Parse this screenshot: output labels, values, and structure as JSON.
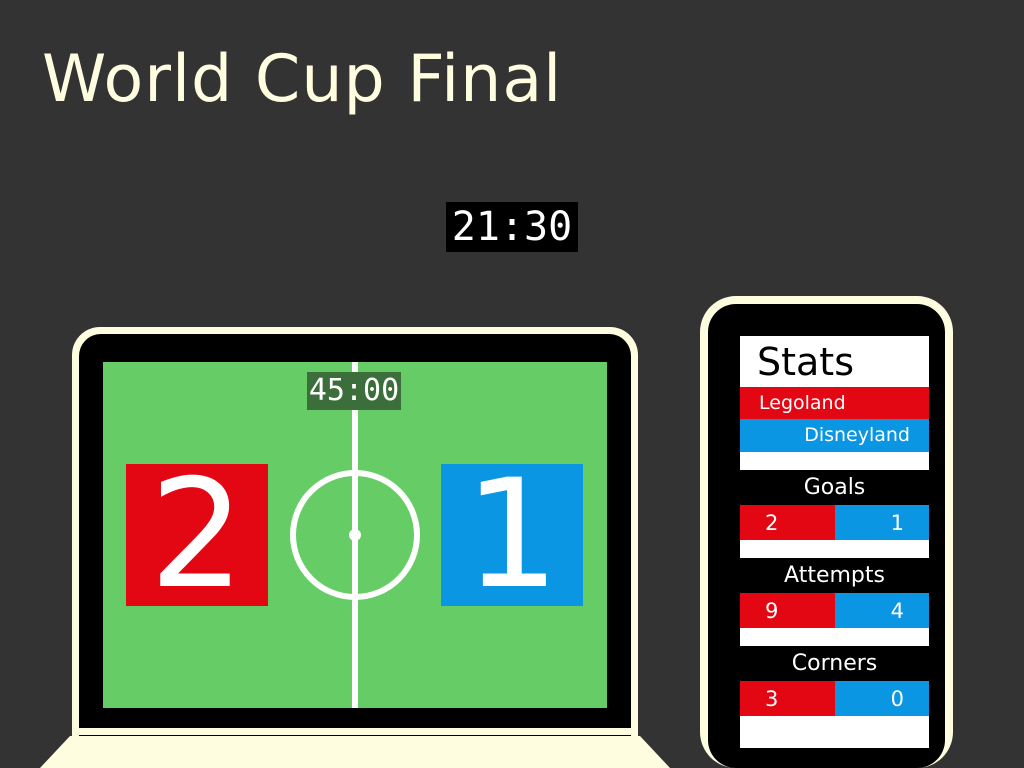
{
  "title": "World Cup Final",
  "clock": "21:30",
  "match": {
    "time": "45:00",
    "home_score": "2",
    "away_score": "1"
  },
  "stats": {
    "header": "Stats",
    "home_team": "Legoland",
    "away_team": "Disneyland",
    "rows": [
      {
        "label": "Goals",
        "home": "2",
        "away": "1"
      },
      {
        "label": "Attempts",
        "home": "9",
        "away": "4"
      },
      {
        "label": "Corners",
        "home": "3",
        "away": "0"
      }
    ]
  },
  "colors": {
    "background": "#333333",
    "device_frame": "#fffddf",
    "pitch": "#66cc66",
    "home": "#e30613",
    "away": "#0b96e3"
  }
}
